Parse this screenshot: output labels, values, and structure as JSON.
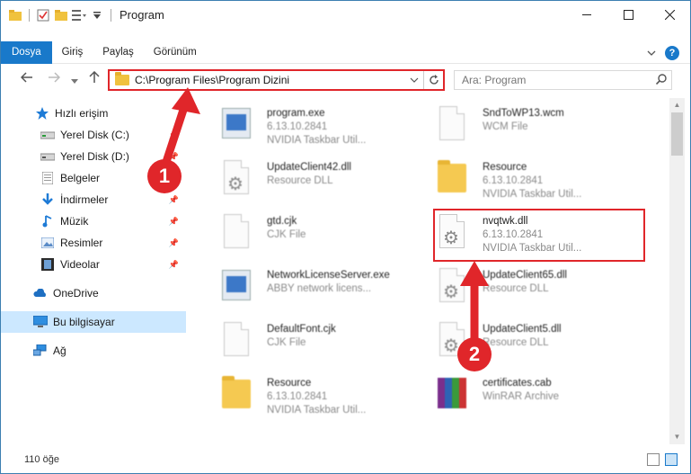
{
  "window": {
    "title": "Program"
  },
  "ribbon": {
    "tabs": [
      {
        "label": "Dosya",
        "active": true
      },
      {
        "label": "Giriş"
      },
      {
        "label": "Paylaş"
      },
      {
        "label": "Görünüm"
      }
    ],
    "help": "?"
  },
  "address": {
    "path": "C:\\Program Files\\Program Dizini"
  },
  "search": {
    "placeholder": "Ara: Program"
  },
  "sidebar": {
    "items": [
      {
        "label": "Hızlı erişim",
        "icon": "star-icon"
      },
      {
        "label": "Yerel Disk (C:)",
        "icon": "drive-icon",
        "pinned": true
      },
      {
        "label": "Yerel Disk (D:)",
        "icon": "drive-icon",
        "pinned": true
      },
      {
        "label": "Belgeler",
        "icon": "documents-icon",
        "pinned": true
      },
      {
        "label": "İndirmeler",
        "icon": "download-icon",
        "pinned": true
      },
      {
        "label": "Müzik",
        "icon": "music-icon",
        "pinned": true
      },
      {
        "label": "Resimler",
        "icon": "pictures-icon",
        "pinned": true
      },
      {
        "label": "Videolar",
        "icon": "videos-icon",
        "pinned": true
      },
      {
        "label": "OneDrive",
        "icon": "onedrive-icon"
      },
      {
        "label": "Bu bilgisayar",
        "icon": "computer-icon",
        "selected": true
      },
      {
        "label": "Ağ",
        "icon": "network-icon"
      }
    ]
  },
  "files": [
    {
      "name": "program.exe",
      "line2": "6.13.10.2841",
      "line3": "NVIDIA Taskbar Util...",
      "icon": "exe-icon"
    },
    {
      "name": "SndToWP13.wcm",
      "line2": "WCM File",
      "line3": "",
      "icon": "document-icon"
    },
    {
      "name": "UpdateClient42.dll",
      "line2": "Resource DLL",
      "line3": "",
      "icon": "dll-icon"
    },
    {
      "name": "Resource",
      "line2": "6.13.10.2841",
      "line3": "NVIDIA Taskbar Util...",
      "icon": "folder-icon"
    },
    {
      "name": "gtd.cjk",
      "line2": "CJK File",
      "line3": "",
      "icon": "document-icon"
    },
    {
      "name": "nvqtwk.dll",
      "line2": "6.13.10.2841",
      "line3": "NVIDIA Taskbar Util...",
      "icon": "dll-icon"
    },
    {
      "name": "NetworkLicenseServer.exe",
      "line2": "ABBY network licens...",
      "line3": "",
      "icon": "exe-icon"
    },
    {
      "name": "UpdateClient65.dll",
      "line2": "Resource DLL",
      "line3": "",
      "icon": "dll-icon"
    },
    {
      "name": "DefaultFont.cjk",
      "line2": "CJK File",
      "line3": "",
      "icon": "document-icon"
    },
    {
      "name": "UpdateClient5.dll",
      "line2": "Resource DLL",
      "line3": "",
      "icon": "dll-icon"
    },
    {
      "name": "Resource",
      "line2": "6.13.10.2841",
      "line3": "NVIDIA Taskbar Util...",
      "icon": "folder-icon"
    },
    {
      "name": "certificates.cab",
      "line2": "WinRAR Archive",
      "line3": "",
      "icon": "archive-icon"
    }
  ],
  "status": {
    "item_count": "110 öğe"
  },
  "callouts": [
    {
      "label": "1"
    },
    {
      "label": "2"
    }
  ],
  "colors": {
    "accent": "#1979ca",
    "highlight": "#e0262a",
    "selected": "#cce8ff"
  }
}
